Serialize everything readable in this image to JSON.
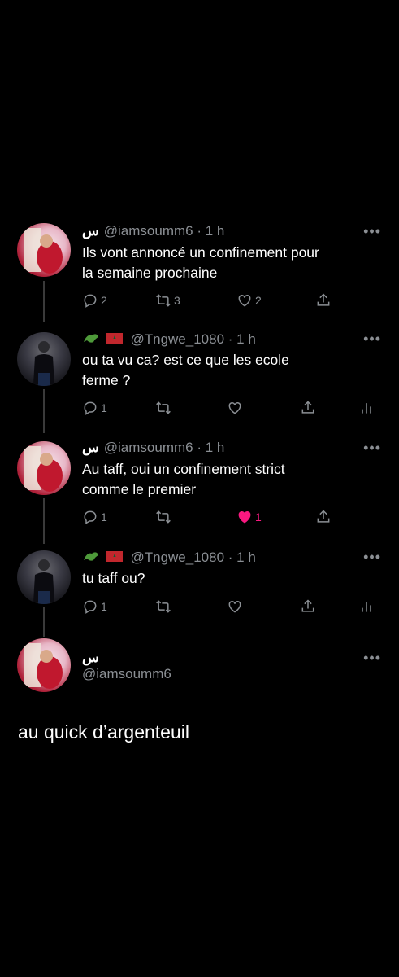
{
  "thread": [
    {
      "display": "س",
      "handle": "@iamsoumm6",
      "time": "· 1 h",
      "lines": [
        "Ils vont annoncé un confinement pour",
        "la semaine prochaine"
      ],
      "replies": "2",
      "retweets": "3",
      "likes": "2"
    },
    {
      "handle": "@Tngwe_1080",
      "time": "· 1 h",
      "lines": [
        "ou ta vu ca? est ce que les ecole",
        "ferme ?"
      ],
      "replies": "1"
    },
    {
      "display": "س",
      "handle": "@iamsoumm6",
      "time": "· 1 h",
      "lines": [
        "Au taff, oui un confinement strict",
        "comme le premier"
      ],
      "replies": "1",
      "likes": "1"
    },
    {
      "handle": "@Tngwe_1080",
      "time": "· 1 h",
      "lines": [
        "tu taff ou?"
      ],
      "replies": "1"
    }
  ],
  "main": {
    "display": "س",
    "handle": "@iamsoumm6",
    "text": "au quick d’argenteuil"
  },
  "more_label": "•••",
  "colors": {
    "background": "#000000",
    "secondary": "#8b8f94",
    "like": "#f91880"
  },
  "icons": [
    "reply-icon",
    "retweet-icon",
    "like-icon",
    "share-icon",
    "analytics-icon",
    "more-icon"
  ]
}
